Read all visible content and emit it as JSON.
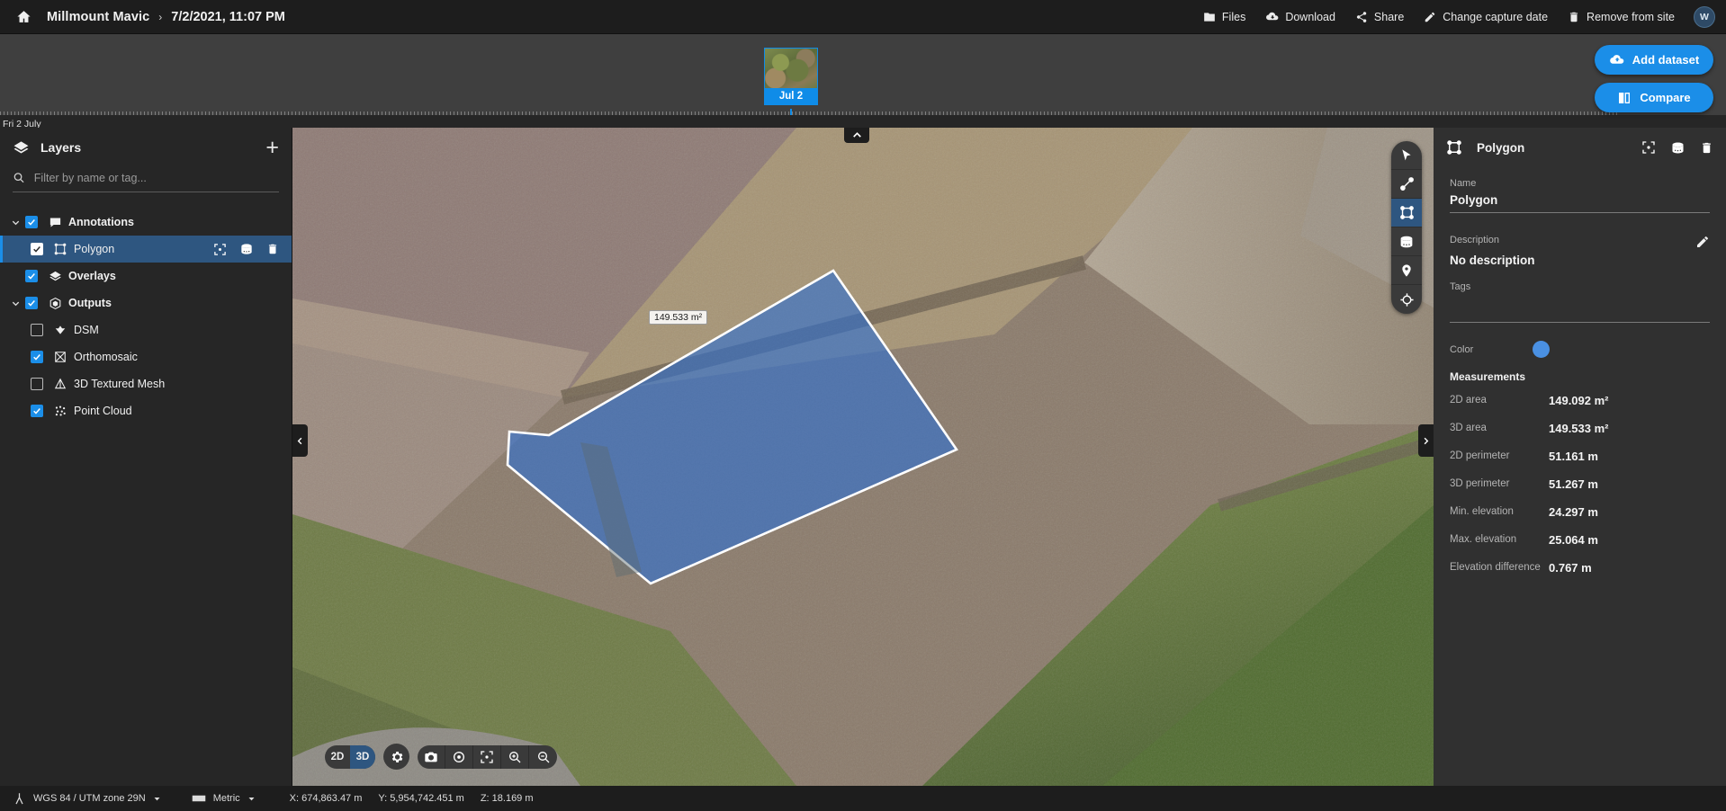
{
  "header": {
    "home_icon": "home-icon",
    "project": "Millmount Mavic",
    "separator": "›",
    "capture_date": "7/2/2021, 11:07 PM",
    "actions": [
      {
        "label": "Files",
        "icon": "folder-icon"
      },
      {
        "label": "Download",
        "icon": "cloud-download-icon"
      },
      {
        "label": "Share",
        "icon": "share-icon"
      },
      {
        "label": "Change capture date",
        "icon": "pencil-icon"
      },
      {
        "label": "Remove from site",
        "icon": "trash-icon"
      }
    ],
    "avatar_initial": "W"
  },
  "cta": {
    "add_dataset": "Add dataset",
    "compare": "Compare"
  },
  "timeline": {
    "day_label": "Fri 2 July",
    "dataset_label": "Jul 2"
  },
  "sidebar": {
    "title": "Layers",
    "add_icon": "plus-icon",
    "search_placeholder": "Filter by name or tag...",
    "search_value": "",
    "nodes": [
      {
        "label": "Annotations",
        "checked": true,
        "expanded": true,
        "icon": "annotation-icon",
        "level": 0,
        "selected": false
      },
      {
        "label": "Polygon",
        "checked": true,
        "expanded": null,
        "icon": "polygon-icon",
        "level": 1,
        "selected": true
      },
      {
        "label": "Overlays",
        "checked": true,
        "expanded": null,
        "icon": "overlays-icon",
        "level": 0,
        "selected": false
      },
      {
        "label": "Outputs",
        "checked": true,
        "expanded": true,
        "icon": "outputs-cube-icon",
        "level": 0,
        "selected": false
      },
      {
        "label": "DSM",
        "checked": false,
        "expanded": null,
        "icon": "dsm-icon",
        "level": 1,
        "selected": false
      },
      {
        "label": "Orthomosaic",
        "checked": true,
        "expanded": null,
        "icon": "orthomosaic-icon",
        "level": 1,
        "selected": false
      },
      {
        "label": "3D Textured Mesh",
        "checked": false,
        "expanded": null,
        "icon": "mesh-icon",
        "level": 1,
        "selected": false
      },
      {
        "label": "Point Cloud",
        "checked": true,
        "expanded": null,
        "icon": "pointcloud-icon",
        "level": 1,
        "selected": false
      }
    ],
    "row_actions": [
      "focus-icon",
      "volume-icon",
      "trash-icon"
    ]
  },
  "map": {
    "polygon_area_label": "149.533 m²",
    "collapse_top_icon": "chevron-up-icon",
    "collapse_left_icon": "chevron-left-icon",
    "collapse_right_icon": "chevron-right-icon",
    "tools": [
      {
        "name": "select-cursor-tool",
        "active": false
      },
      {
        "name": "distance-line-tool",
        "active": false
      },
      {
        "name": "polygon-area-tool",
        "active": true
      },
      {
        "name": "volume-stockpile-tool",
        "active": false
      },
      {
        "name": "marker-pin-tool",
        "active": false
      },
      {
        "name": "orbit-target-tool",
        "active": false
      }
    ],
    "view_2d": "2D",
    "view_3d": "3D",
    "view_active": "3D",
    "bottom_tools": [
      {
        "name": "settings-gear-button"
      },
      {
        "name": "camera-snapshot-button"
      },
      {
        "name": "target-center-button"
      },
      {
        "name": "fit-view-button"
      },
      {
        "name": "zoom-in-button"
      },
      {
        "name": "zoom-out-button"
      }
    ]
  },
  "details": {
    "header_icon": "polygon-icon",
    "title": "Polygon",
    "header_actions": [
      "focus-icon",
      "volume-icon",
      "trash-icon"
    ],
    "name_label": "Name",
    "name_value": "Polygon",
    "description_label": "Description",
    "description_value": "No description",
    "description_edit_icon": "pencil-icon",
    "tags_label": "Tags",
    "tags_value": "",
    "color_label": "Color",
    "color_value": "#4a90e2",
    "measurements_title": "Measurements",
    "measurements": [
      {
        "key": "2D area",
        "value": "149.092 m²"
      },
      {
        "key": "3D area",
        "value": "149.533 m²"
      },
      {
        "key": "2D perimeter",
        "value": "51.161 m"
      },
      {
        "key": "3D perimeter",
        "value": "51.267 m"
      },
      {
        "key": "Min. elevation",
        "value": "24.297 m"
      },
      {
        "key": "Max. elevation",
        "value": "25.064 m"
      },
      {
        "key": "Elevation difference",
        "value": "0.767 m"
      }
    ]
  },
  "statusbar": {
    "crs_icon": "crs-icon",
    "crs": "WGS 84 / UTM zone 29N",
    "units_icon": "ruler-icon",
    "units": "Metric",
    "dropdown_icon": "caret-down-icon",
    "coord_x": "X: 674,863.47 m",
    "coord_y": "Y: 5,954,742.451 m",
    "coord_z": "Z: 18.169 m"
  }
}
